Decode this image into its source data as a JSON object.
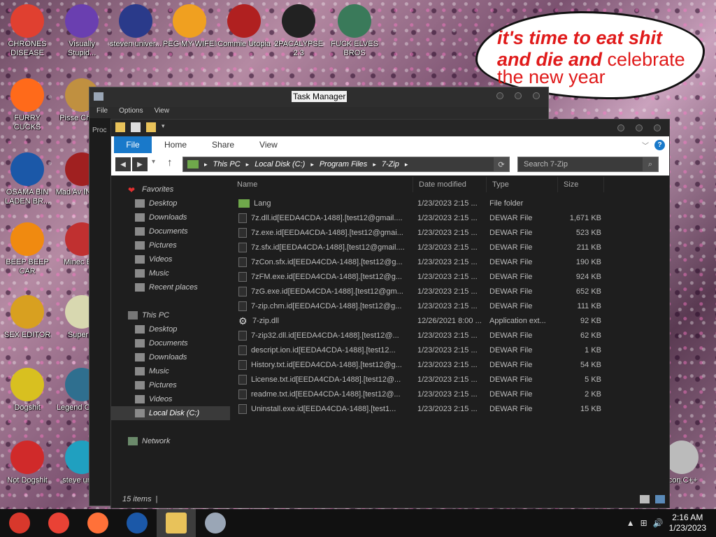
{
  "desktop": {
    "icons": [
      {
        "label": "CHRONES DISEASE",
        "color": "#e04030"
      },
      {
        "label": "Visually Stupid...",
        "color": "#6a3fb0"
      },
      {
        "label": "steven univer...",
        "color": "#2a3a8a"
      },
      {
        "label": "PEG MY WIFE!",
        "color": "#f0a020"
      },
      {
        "label": "Commie Utopia",
        "color": "#b02020"
      },
      {
        "label": "2PACALYPSE 2.3",
        "color": "#222222"
      },
      {
        "label": "FUCK ELVES BROS",
        "color": "#3a7a5a"
      },
      {
        "label": "FURRY CUCKS",
        "color": "#ff6a1a"
      },
      {
        "label": "Pisse Chicke",
        "color": "#c09040"
      },
      {
        "label": "OSAMA BIN LADEN BR...",
        "color": "#1b58a8"
      },
      {
        "label": "Mad Av IN SPA",
        "color": "#a02020"
      },
      {
        "label": "BEEP BEEP CAR",
        "color": "#f08a10"
      },
      {
        "label": "Minec Bird",
        "color": "#c03030"
      },
      {
        "label": "SEX EDITOR",
        "color": "#d8a020"
      },
      {
        "label": "Super C",
        "color": "#d8d8b0"
      },
      {
        "label": "Dogshit",
        "color": "#d8c020"
      },
      {
        "label": "Legend CRYAI",
        "color": "#2f6f8f"
      },
      {
        "label": "Not Dogshit",
        "color": "#d02a2a"
      },
      {
        "label": "steve unive",
        "color": "#20a0c0"
      },
      {
        "label": "Icon C++",
        "color": "#bbbbbb"
      }
    ],
    "meme": {
      "line1": "it's time to eat shit",
      "line2a": "and die and",
      "line2b": "celebrate",
      "line3": "the new year"
    }
  },
  "taskmgr": {
    "title": "Task Manager",
    "menu": [
      "File",
      "Options",
      "View"
    ],
    "tab_partial": "Proc"
  },
  "explorer": {
    "ribbon": {
      "file": "File",
      "tabs": [
        "Home",
        "Share",
        "View"
      ],
      "help": "?"
    },
    "address": {
      "crumbs": [
        "This PC",
        "Local Disk (C:)",
        "Program Files",
        "7-Zip"
      ]
    },
    "search_placeholder": "Search 7-Zip",
    "nav": {
      "favorites_header": "Favorites",
      "favorites": [
        "Desktop",
        "Downloads",
        "Documents",
        "Pictures",
        "Videos",
        "Music",
        "Recent places"
      ],
      "thispc_header": "This PC",
      "thispc": [
        "Desktop",
        "Documents",
        "Downloads",
        "Music",
        "Pictures",
        "Videos",
        "Local Disk (C:)"
      ],
      "network": "Network"
    },
    "columns": {
      "name": "Name",
      "date": "Date modified",
      "type": "Type",
      "size": "Size"
    },
    "files": [
      {
        "name": "Lang",
        "date": "1/23/2023 2:15 ...",
        "type": "File folder",
        "size": "",
        "icon": "folder"
      },
      {
        "name": "7z.dll.id[EEDA4CDA-1488].[test12@gmail....",
        "date": "1/23/2023 2:15 ...",
        "type": "DEWAR File",
        "size": "1,671 KB",
        "icon": "file"
      },
      {
        "name": "7z.exe.id[EEDA4CDA-1488].[test12@gmai...",
        "date": "1/23/2023 2:15 ...",
        "type": "DEWAR File",
        "size": "523 KB",
        "icon": "file"
      },
      {
        "name": "7z.sfx.id[EEDA4CDA-1488].[test12@gmail....",
        "date": "1/23/2023 2:15 ...",
        "type": "DEWAR File",
        "size": "211 KB",
        "icon": "file"
      },
      {
        "name": "7zCon.sfx.id[EEDA4CDA-1488].[test12@g...",
        "date": "1/23/2023 2:15 ...",
        "type": "DEWAR File",
        "size": "190 KB",
        "icon": "file"
      },
      {
        "name": "7zFM.exe.id[EEDA4CDA-1488].[test12@g...",
        "date": "1/23/2023 2:15 ...",
        "type": "DEWAR File",
        "size": "924 KB",
        "icon": "file"
      },
      {
        "name": "7zG.exe.id[EEDA4CDA-1488].[test12@gm...",
        "date": "1/23/2023 2:15 ...",
        "type": "DEWAR File",
        "size": "652 KB",
        "icon": "file"
      },
      {
        "name": "7-zip.chm.id[EEDA4CDA-1488].[test12@g...",
        "date": "1/23/2023 2:15 ...",
        "type": "DEWAR File",
        "size": "111 KB",
        "icon": "file"
      },
      {
        "name": "7-zip.dll",
        "date": "12/26/2021 8:00 ...",
        "type": "Application ext...",
        "size": "92 KB",
        "icon": "gear"
      },
      {
        "name": "7-zip32.dll.id[EEDA4CDA-1488].[test12@...",
        "date": "1/23/2023 2:15 ...",
        "type": "DEWAR File",
        "size": "62 KB",
        "icon": "file"
      },
      {
        "name": "descript.ion.id[EEDA4CDA-1488].[test12...",
        "date": "1/23/2023 2:15 ...",
        "type": "DEWAR File",
        "size": "1 KB",
        "icon": "file"
      },
      {
        "name": "History.txt.id[EEDA4CDA-1488].[test12@g...",
        "date": "1/23/2023 2:15 ...",
        "type": "DEWAR File",
        "size": "54 KB",
        "icon": "file"
      },
      {
        "name": "License.txt.id[EEDA4CDA-1488].[test12@...",
        "date": "1/23/2023 2:15 ...",
        "type": "DEWAR File",
        "size": "5 KB",
        "icon": "file"
      },
      {
        "name": "readme.txt.id[EEDA4CDA-1488].[test12@...",
        "date": "1/23/2023 2:15 ...",
        "type": "DEWAR File",
        "size": "2 KB",
        "icon": "file"
      },
      {
        "name": "Uninstall.exe.id[EEDA4CDA-1488].[test1...",
        "date": "1/23/2023 2:15 ...",
        "type": "DEWAR File",
        "size": "15 KB",
        "icon": "file"
      }
    ],
    "status": "15 items"
  },
  "taskbar": {
    "apps": [
      {
        "name": "chrome-task-icon",
        "color": "#d8382c",
        "active": false
      },
      {
        "name": "chrome-task-icon",
        "color": "#e94235",
        "active": false
      },
      {
        "name": "firefox-task-icon",
        "color": "#ff7139",
        "active": false
      },
      {
        "name": "obama-task-icon",
        "color": "#1b58a8",
        "active": false
      },
      {
        "name": "explorer-task-icon",
        "color": "#e8c25a",
        "active": true
      },
      {
        "name": "taskmgr-task-icon",
        "color": "#9aa6b6",
        "active": false
      }
    ],
    "time": "2:16 AM",
    "date": "1/23/2023"
  }
}
